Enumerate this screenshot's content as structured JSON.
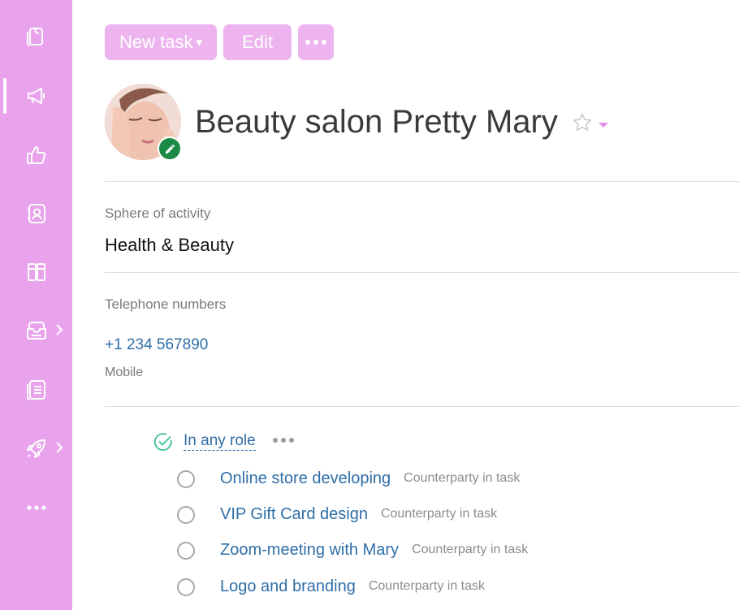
{
  "toolbar": {
    "new_task_label": "New task",
    "new_task_arrow": "▾",
    "edit_label": "Edit",
    "more_icon": "more-dots-icon"
  },
  "header": {
    "title": "Beauty salon Pretty Mary",
    "avatar_icon": "avatar-photo",
    "badge_icon": "pencil-icon"
  },
  "fields": {
    "sphere_label": "Sphere of activity",
    "sphere_value": "Health & Beauty",
    "phones_label": "Telephone numbers",
    "phone_number": "+1 234 567890",
    "phone_type": "Mobile"
  },
  "tasks_group": {
    "role_filter": "In any role",
    "items": [
      {
        "name": "Online store developing",
        "role": "Counterparty in task"
      },
      {
        "name": "VIP Gift Card design",
        "role": "Counterparty in task"
      },
      {
        "name": "Zoom-meeting with Mary",
        "role": "Counterparty in task"
      },
      {
        "name": "Logo and branding",
        "role": "Counterparty in task"
      }
    ]
  },
  "sidebar": {
    "items": [
      {
        "icon": "documents-icon"
      },
      {
        "icon": "megaphone-icon",
        "active": true
      },
      {
        "icon": "thumbs-up-icon"
      },
      {
        "icon": "contacts-icon"
      },
      {
        "icon": "books-icon"
      },
      {
        "icon": "inbox-tray-icon",
        "has_submenu": true
      },
      {
        "icon": "list-document-icon"
      },
      {
        "icon": "rocket-icon",
        "has_submenu": true
      },
      {
        "icon": "more-dots-icon"
      }
    ]
  },
  "colors": {
    "sidebar_bg": "#e9a3ec",
    "button_bg": "#edb4ef",
    "link": "#2f6ea8",
    "badge_green": "#1a8a45"
  }
}
